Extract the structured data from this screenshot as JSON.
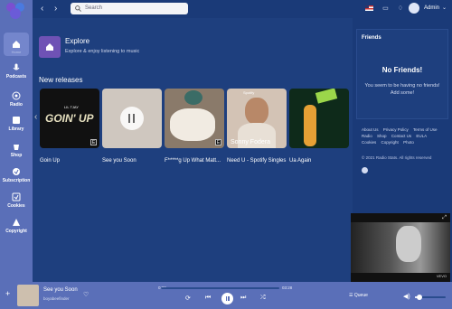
{
  "topbar": {
    "search_placeholder": "Search",
    "user_name": "Admin"
  },
  "sidebar": {
    "items": [
      {
        "label": "Home"
      },
      {
        "label": "Podcasts"
      },
      {
        "label": "Radio"
      },
      {
        "label": "Library"
      },
      {
        "label": "Shop"
      },
      {
        "label": "Subscription"
      },
      {
        "label": "Cookies"
      },
      {
        "label": "Copyright"
      }
    ]
  },
  "explore": {
    "title": "Explore",
    "subtitle": "Explore & enjoy listening to music"
  },
  "releases": {
    "title": "New releases",
    "items": [
      {
        "title": "Goin Up",
        "art_text": "GOIN' UP",
        "art_artist": "LIL TJAY"
      },
      {
        "title": "See you Soon"
      },
      {
        "title": "F*****g Up What Matt..."
      },
      {
        "title": "Need U - Spotify Singles",
        "art_text": "Sonny Fodera",
        "art_tag": "Spotify"
      },
      {
        "title": "Ua Again"
      }
    ]
  },
  "friends": {
    "title": "Friends",
    "empty_title": "No Friends!",
    "empty_line1": "You seem to be having no friends!",
    "empty_line2": "Add some!"
  },
  "footer": {
    "links": [
      "About Us",
      "Privacy Policy",
      "Terms of Use",
      "Radio",
      "Shop",
      "Contact Us",
      "EULA",
      "Cookies",
      "Copyright",
      "Photo"
    ],
    "copyright": "© 2021 Radio Stats. All rights reserved"
  },
  "video": {
    "label": "VEVO"
  },
  "player": {
    "title": "See you Soon",
    "artist": "boyabeefinder",
    "elapsed": "0:00",
    "duration": "03:28",
    "progress_fraction": 0.0,
    "queue_label": "Queue",
    "volume_fraction": 0.15
  },
  "colors": {
    "sidebar": "#5a6fb8",
    "background": "#1a3a78",
    "panel": "#1e3f7e",
    "accent": "#6f52b5"
  }
}
